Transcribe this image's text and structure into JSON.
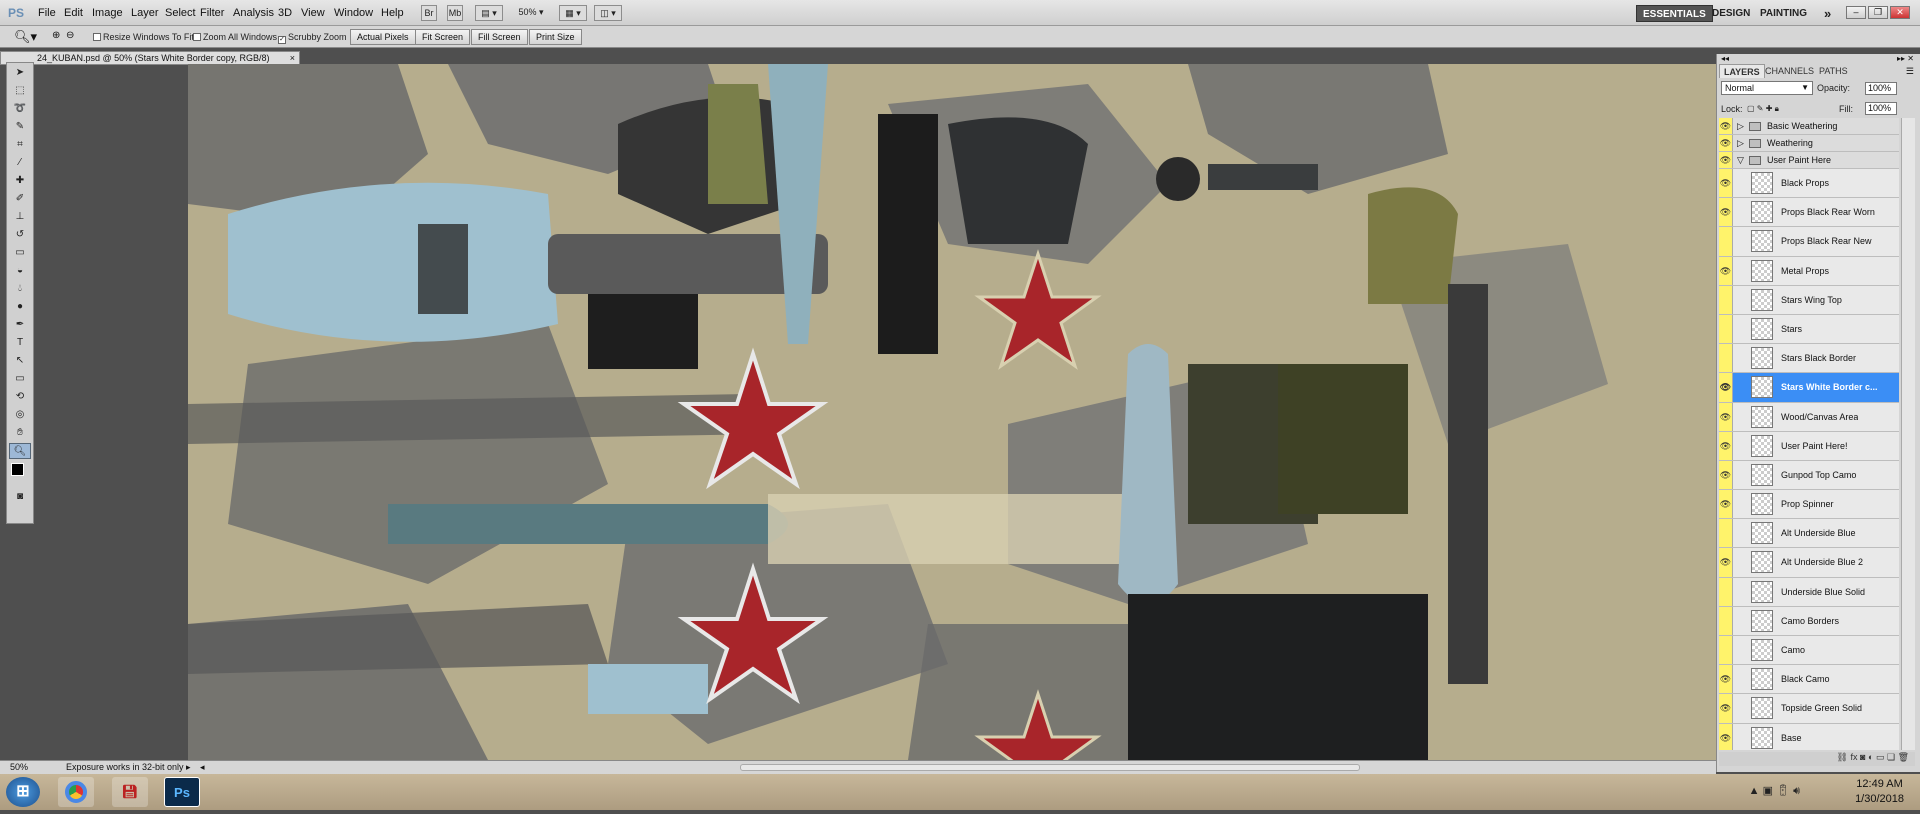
{
  "menubar": {
    "logo": "PS",
    "items": [
      "File",
      "Edit",
      "Image",
      "Layer",
      "Select",
      "Filter",
      "Analysis",
      "3D",
      "View",
      "Window",
      "Help"
    ],
    "zoom": "50%",
    "workspaces": [
      "ESSENTIALS",
      "DESIGN",
      "PAINTING"
    ],
    "more": "»"
  },
  "options": {
    "resize_windows": "Resize Windows To Fit",
    "zoom_all": "Zoom All Windows",
    "scrubby": "Scrubby Zoom",
    "buttons": [
      "Actual Pixels",
      "Fit Screen",
      "Fill Screen",
      "Print Size"
    ]
  },
  "document": {
    "tab_title": "24_KUBAN.psd @ 50% (Stars White Border copy, RGB/8)",
    "close": "×"
  },
  "status": {
    "zoom": "50%",
    "message": "Exposure works in 32-bit only"
  },
  "panel": {
    "tabs": [
      "LAYERS",
      "CHANNELS",
      "PATHS"
    ],
    "blend_mode": "Normal",
    "opacity_label": "Opacity:",
    "opacity": "100%",
    "lock_label": "Lock:",
    "fill_label": "Fill:",
    "fill": "100%",
    "layers": [
      {
        "name": "Basic Weathering",
        "group": true,
        "expanded": false,
        "visible": true
      },
      {
        "name": "Weathering",
        "group": true,
        "expanded": false,
        "visible": true
      },
      {
        "name": "User Paint Here",
        "group": true,
        "expanded": true,
        "visible": true
      },
      {
        "name": "Black Props",
        "visible": true
      },
      {
        "name": "Props Black Rear Worn",
        "visible": true
      },
      {
        "name": "Props Black Rear New",
        "visible": false
      },
      {
        "name": "Metal Props",
        "visible": true
      },
      {
        "name": "Stars Wing Top",
        "visible": false
      },
      {
        "name": "Stars",
        "visible": false
      },
      {
        "name": "Stars Black Border",
        "visible": false
      },
      {
        "name": "Stars White Border c...",
        "visible": true,
        "selected": true
      },
      {
        "name": "Wood/Canvas Area",
        "visible": true
      },
      {
        "name": "User Paint Here!",
        "visible": true
      },
      {
        "name": "Gunpod Top Camo",
        "visible": true
      },
      {
        "name": "Prop Spinner",
        "visible": true
      },
      {
        "name": "Alt Underside Blue",
        "visible": false
      },
      {
        "name": "Alt Underside Blue 2",
        "visible": true
      },
      {
        "name": "Underside Blue Solid",
        "visible": false
      },
      {
        "name": "Camo Borders",
        "visible": false
      },
      {
        "name": "Camo",
        "visible": false
      },
      {
        "name": "Black Camo",
        "visible": true
      },
      {
        "name": "Topside Green Solid",
        "visible": true
      },
      {
        "name": "Base",
        "visible": true
      }
    ]
  },
  "taskbar": {
    "time": "12:49 AM",
    "date": "1/30/2018",
    "apps": [
      "start-orb-icon",
      "chrome-icon",
      "floppy-icon",
      "photoshop-icon"
    ],
    "ps_label": "Ps"
  },
  "colors": {
    "star_red": "#a8252a",
    "camo_tan": "#b6ad8d",
    "camo_grey": "#6b6b6b",
    "underside_blue": "#9fc0cf",
    "selection_blue": "#3b8ef5",
    "eye_yellow": "#fff36b"
  }
}
